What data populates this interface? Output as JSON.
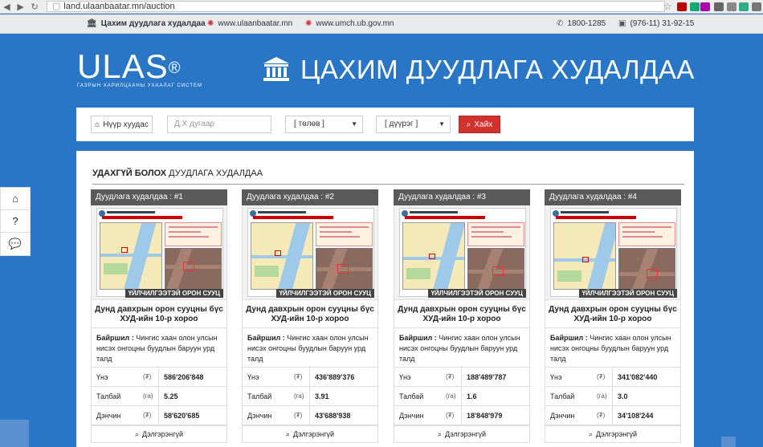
{
  "browser": {
    "url": "land.ulaanbaatar.mn/auction",
    "extension_colors": [
      "#b00",
      "#1a7",
      "#a0a",
      "#666",
      "#888",
      "#3a8",
      "#777",
      "#555"
    ]
  },
  "topbar": {
    "site_name": "Цахим дуудлага худалдаа",
    "link1": "www.ulaanbaatar.mn",
    "link2": "www.umch.ub.gov.mn",
    "phone1": "1800-1285",
    "phone2": "(976-11) 31-92-15"
  },
  "header": {
    "logo_text": "ULAS",
    "logo_reg": "®",
    "logo_subtitle": "ГАЗРЫН ХАРИЛЦААНЫ УХААЛАГ СИСТЕМ",
    "title": "ЦАХИМ ДУУДЛАГА ХУДАЛДАА"
  },
  "search": {
    "home_label": "Нүүр хуудас",
    "number_placeholder": "Д.Х дугаар",
    "status_select": "[ төлөв ]",
    "district_select": "[ дүүрэг ]",
    "search_label": "Хайх"
  },
  "section": {
    "title_bold": "УДАХГҮЙ БОЛОХ",
    "title_rest": "ДУУДЛАГА ХУДАЛДАА"
  },
  "labels": {
    "location": "Байршил :",
    "price": "Үнэ",
    "area": "Талбай",
    "deposit": "Дэнчин",
    "currency": "₮",
    "area_unit": "(га)",
    "details": "Дэлгэрэнгүй",
    "banner": "ҮЙЛЧИЛГЭЭТЭЙ ОРОН СУУЦ"
  },
  "cards": [
    {
      "head": "Дуудлага худалдаа : #1",
      "name": "Дунд давхрын орон сууцны бүс ХУД-ийн 10-р хороо",
      "location": "Чингис хаан олон улсын нисэх онгоцны буудлын баруун урд талд",
      "price": "586'206'848",
      "area": "5.25",
      "deposit": "58'620'685"
    },
    {
      "head": "Дуудлага худалдаа : #2",
      "name": "Дунд давхрын орон сууцны бүс ХУД-ийн 10-р хороо",
      "location": "Чингис хаан олон улсын нисэх онгоцны буудлын баруун урд талд",
      "price": "436'889'376",
      "area": "3.91",
      "deposit": "43'688'938"
    },
    {
      "head": "Дуудлага худалдаа : #3",
      "name": "Дунд давхрын орон сууцны бүс ХУД-ийн 10-р хороо",
      "location": "Чингис хаан олон улсын нисэх онгоцны буудлын баруун урд талд",
      "price": "188'489'787",
      "area": "1.6",
      "deposit": "18'848'979"
    },
    {
      "head": "Дуудлага худалдаа : #4",
      "name": "Дунд давхрын орон сууцны бүс ХУД-ийн 10-р хороо",
      "location": "Чингис хаан олон улсын нисэх онгоцны буудлын баруун урд талд",
      "price": "341'082'440",
      "area": "3.0",
      "deposit": "34'108'244"
    }
  ],
  "side": {
    "help": "?"
  }
}
